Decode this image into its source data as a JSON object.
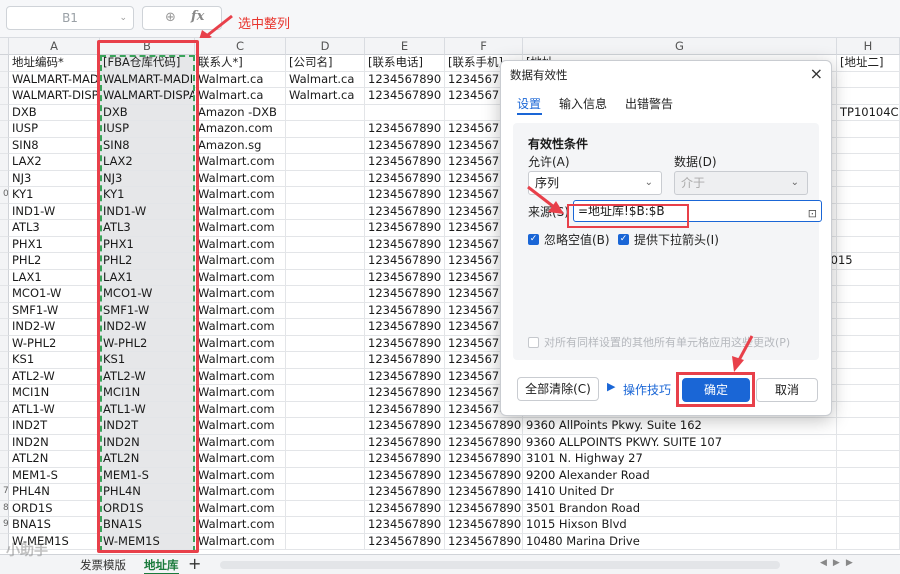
{
  "formula_bar": {
    "name_box": "B1",
    "fx": "fx"
  },
  "annotation": "选中整列",
  "columns": [
    "A",
    "B",
    "C",
    "D",
    "E",
    "F",
    "G",
    "H"
  ],
  "row_numbers": [
    "",
    "",
    "",
    "",
    "",
    "",
    "",
    "",
    "0",
    "",
    "",
    "",
    "",
    "",
    "",
    "",
    "",
    "",
    "",
    "",
    "",
    "",
    "",
    "",
    "",
    "",
    "7",
    "8",
    "9",
    "",
    "",
    ""
  ],
  "rows": [
    [
      "地址编码*",
      "[FBA仓库代码]",
      "联系人*]",
      "[公司名]",
      "[联系电话]",
      "[联系手机]",
      "[地址一",
      "[地址二]"
    ],
    [
      "WALMART-MADI",
      "WALMART-MADI",
      "Walmart.ca",
      "Walmart.ca",
      "1234567890",
      "12345678",
      "",
      ""
    ],
    [
      "WALMART-DISPA",
      "WALMART-DISPA",
      "Walmart.ca",
      "Walmart.ca",
      "1234567890",
      "12345678",
      "",
      ""
    ],
    [
      "DXB",
      "DXB",
      "Amazon -DXB",
      "",
      "",
      "",
      "",
      "TP10104C a"
    ],
    [
      "IUSP",
      "IUSP",
      "Amazon.com",
      "",
      "1234567890",
      "12345678",
      "",
      ""
    ],
    [
      "SIN8",
      "SIN8",
      "Amazon.sg",
      "",
      "1234567890",
      "12345678",
      "",
      ""
    ],
    [
      "LAX2",
      "LAX2",
      "Walmart.com",
      "",
      "1234567890",
      "12345678",
      "",
      ""
    ],
    [
      "NJ3",
      "NJ3",
      "Walmart.com",
      "",
      "1234567890",
      "12345678",
      "",
      ""
    ],
    [
      "KY1",
      "KY1",
      "Walmart.com",
      "",
      "1234567890",
      "12345678",
      "",
      ""
    ],
    [
      "IND1-W",
      "IND1-W",
      "Walmart.com",
      "",
      "1234567890",
      "12345678",
      "",
      ""
    ],
    [
      "ATL3",
      "ATL3",
      "Walmart.com",
      "",
      "1234567890",
      "12345678",
      "",
      ""
    ],
    [
      "PHX1",
      "PHX1",
      "Walmart.com",
      "",
      "1234567890",
      "12345678",
      "",
      ""
    ],
    [
      "PHL2",
      "PHL2",
      "Walmart.com",
      "",
      "1234567890",
      "12345678",
      "",
      "18015"
    ],
    [
      "LAX1",
      "LAX1",
      "Walmart.com",
      "",
      "1234567890",
      "12345678",
      "",
      ""
    ],
    [
      "MCO1-W",
      "MCO1-W",
      "Walmart.com",
      "",
      "1234567890",
      "12345678",
      "",
      ""
    ],
    [
      "SMF1-W",
      "SMF1-W",
      "Walmart.com",
      "",
      "1234567890",
      "12345678",
      "",
      ""
    ],
    [
      "IND2-W",
      "IND2-W",
      "Walmart.com",
      "",
      "1234567890",
      "12345678",
      "",
      ""
    ],
    [
      "W-PHL2",
      "W-PHL2",
      "Walmart.com",
      "",
      "1234567890",
      "12345678",
      "",
      ""
    ],
    [
      "KS1",
      "KS1",
      "Walmart.com",
      "",
      "1234567890",
      "12345678",
      "",
      ""
    ],
    [
      "ATL2-W",
      "ATL2-W",
      "Walmart.com",
      "",
      "1234567890",
      "12345678",
      "",
      ""
    ],
    [
      "MCI1N",
      "MCI1N",
      "Walmart.com",
      "",
      "1234567890",
      "12345678",
      "",
      ""
    ],
    [
      "ATL1-W",
      "ATL1-W",
      "Walmart.com",
      "",
      "1234567890",
      "12345678",
      "",
      ""
    ],
    [
      "IND2T",
      "IND2T",
      "Walmart.com",
      "",
      "1234567890",
      "1234567890",
      "9360 AllPoints Pkwy. Suite 162",
      ""
    ],
    [
      "IND2N",
      "IND2N",
      "Walmart.com",
      "",
      "1234567890",
      "1234567890",
      "9360 ALLPOINTS PKWY. SUITE 107",
      ""
    ],
    [
      "ATL2N",
      "ATL2N",
      "Walmart.com",
      "",
      "1234567890",
      "1234567890",
      "3101 N. Highway 27",
      ""
    ],
    [
      "MEM1-S",
      "MEM1-S",
      "Walmart.com",
      "",
      "1234567890",
      "1234567890",
      "9200 Alexander Road",
      ""
    ],
    [
      "PHL4N",
      "PHL4N",
      "Walmart.com",
      "",
      "1234567890",
      "1234567890",
      "1410 United Dr",
      ""
    ],
    [
      "ORD1S",
      "ORD1S",
      "Walmart.com",
      "",
      "1234567890",
      "1234567890",
      "3501 Brandon Road",
      ""
    ],
    [
      "BNA1S",
      "BNA1S",
      "Walmart.com",
      "",
      "1234567890",
      "1234567890",
      "1015 Hixson Blvd",
      ""
    ],
    [
      "W-MEM1S",
      "W-MEM1S",
      "Walmart.com",
      "",
      "1234567890",
      "1234567890",
      "10480 Marina Drive",
      ""
    ]
  ],
  "sheet_tabs": [
    "发票模版",
    "地址库"
  ],
  "active_tab": "地址库",
  "watermark": "小助手",
  "dialog": {
    "title": "数据有效性",
    "close": "×",
    "tabs": [
      "设置",
      "输入信息",
      "出错警告"
    ],
    "section_title": "有效性条件",
    "allow_label": "允许(A)",
    "allow_value": "序列",
    "data_label": "数据(D)",
    "data_value": "介于",
    "source_label": "来源(S)",
    "source_value": "=地址库!$B:$B",
    "ignore_blank": "忽略空值(B)",
    "dropdown_arrow": "提供下拉箭头(I)",
    "apply_all": "对所有同样设置的其他所有单元格应用这些更改(P)",
    "clear_all": "全部清除(C)",
    "tips": "操作技巧",
    "ok": "确定",
    "cancel": "取消"
  },
  "colors": {
    "accent": "#1a66d6",
    "highlight_red": "#e8404a",
    "selection_green": "#3aa45a",
    "tab_green": "#1a7a3c"
  }
}
